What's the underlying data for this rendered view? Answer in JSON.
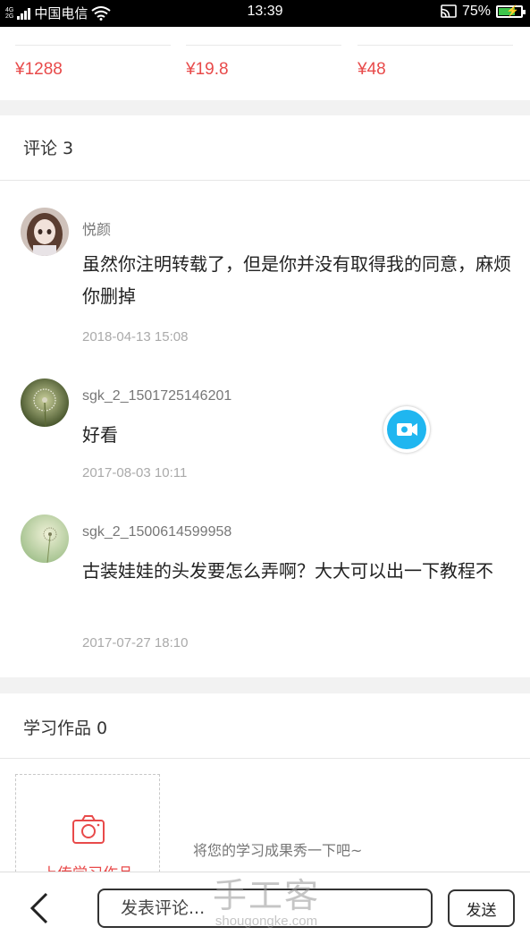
{
  "status_bar": {
    "carrier": "中国电信",
    "network": [
      "4G",
      "2G"
    ],
    "time": "13:39",
    "battery": "75%",
    "battery_level": 0.75
  },
  "products": [
    {
      "price": "¥1288"
    },
    {
      "price": "¥19.8"
    },
    {
      "price": "¥48"
    }
  ],
  "comments_section": {
    "title": "评论 3",
    "items": [
      {
        "username": "悦颜",
        "text": "虽然你注明转载了，但是你并没有取得我的同意，麻烦你删掉",
        "time": "2018-04-13 15:08",
        "avatar": "doll-avatar"
      },
      {
        "username": "sgk_2_1501725146201",
        "text": "好看",
        "time": "2017-08-03 10:11",
        "avatar": "dandelion-avatar"
      },
      {
        "username": "sgk_2_1500614599958",
        "text": "古装娃娃的头发要怎么弄啊？大大可以出一下教程不",
        "time": "2017-07-27 18:10",
        "avatar": "dandelion-avatar"
      }
    ]
  },
  "works_section": {
    "title": "学习作品 0",
    "upload_label": "上传学习作品",
    "hint": "将您的学习成果秀一下吧~"
  },
  "bottom_bar": {
    "placeholder": "发表评论...",
    "send_label": "发送"
  },
  "watermark": {
    "cn": "手工客",
    "en": "shougongke.com"
  },
  "colors": {
    "price": "#e84a4a",
    "accent_blue": "#1fb6f0",
    "section_gap": "#f2f2f2"
  }
}
